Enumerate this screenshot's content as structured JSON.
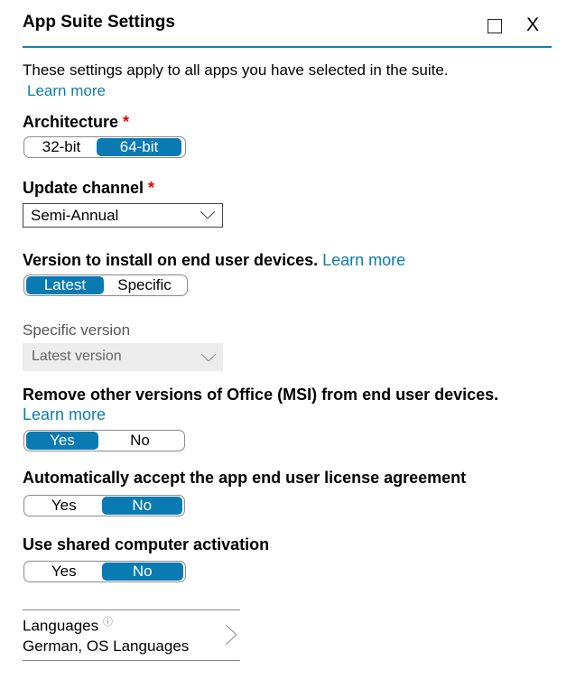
{
  "window": {
    "title": "App Suite Settings",
    "maximize_icon": "maximize-square-icon",
    "close_label": "X"
  },
  "intro": {
    "text": "These settings apply to all apps you have selected in the suite.",
    "learn_more": "Learn more"
  },
  "architecture": {
    "label": "Architecture",
    "required": "*",
    "options": [
      "32-bit",
      "64-bit"
    ],
    "selected": "64-bit"
  },
  "update_channel": {
    "label": "Update channel",
    "required": "*",
    "value": "Semi-Annual"
  },
  "version": {
    "label": "Version to install on end user devices.",
    "learn_more": "Learn more",
    "options": [
      "Latest",
      "Specific"
    ],
    "selected": "Latest"
  },
  "specific_version": {
    "label": "Specific version",
    "value": "Latest version",
    "disabled": true
  },
  "remove_msi": {
    "label": "Remove other versions of Office (MSI) from end user devices.",
    "learn_more": "Learn more",
    "options": [
      "Yes",
      "No"
    ],
    "selected": "Yes"
  },
  "eula": {
    "label": "Automatically accept the app end user license agreement",
    "options": [
      "Yes",
      "No"
    ],
    "selected": "No"
  },
  "shared_activation": {
    "label": "Use shared computer activation",
    "options": [
      "Yes",
      "No"
    ],
    "selected": "No"
  },
  "languages": {
    "label": "Languages",
    "info_icon": "ⓘ",
    "value": "German, OS Languages"
  },
  "colors": {
    "accent": "#0a7ab3",
    "link": "#0e7bb0",
    "required": "#e00000",
    "divider": "#1a7fa8"
  }
}
